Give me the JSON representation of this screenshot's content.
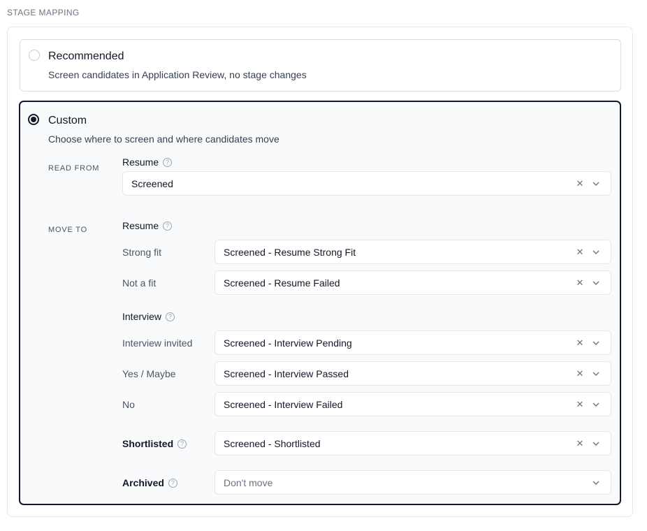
{
  "section_title": "STAGE MAPPING",
  "recommended": {
    "title": "Recommended",
    "description": "Screen candidates in Application Review, no stage changes"
  },
  "custom": {
    "title": "Custom",
    "description": "Choose where to screen and where candidates move",
    "read_from": {
      "side_label": "READ FROM",
      "group_label": "Resume",
      "value": "Screened"
    },
    "move_to": {
      "side_label": "MOVE TO",
      "resume": {
        "group_label": "Resume",
        "rows": [
          {
            "label": "Strong fit",
            "value": "Screened - Resume Strong Fit"
          },
          {
            "label": "Not a fit",
            "value": "Screened - Resume Failed"
          }
        ]
      },
      "interview": {
        "group_label": "Interview",
        "rows": [
          {
            "label": "Interview invited",
            "value": "Screened - Interview Pending"
          },
          {
            "label": "Yes / Maybe",
            "value": "Screened - Interview Passed"
          },
          {
            "label": "No",
            "value": "Screened - Interview Failed"
          }
        ]
      },
      "shortlisted": {
        "label": "Shortlisted",
        "value": "Screened - Shortlisted"
      },
      "archived": {
        "label": "Archived",
        "placeholder": "Don't move"
      }
    }
  },
  "icons": {
    "help": "help-circle-icon",
    "clear": "close-icon",
    "dropdown": "chevron-down-icon"
  },
  "colors": {
    "selected_border": "#111827",
    "unselected_border": "#d6dee6",
    "selected_background": "#f8fafc"
  }
}
